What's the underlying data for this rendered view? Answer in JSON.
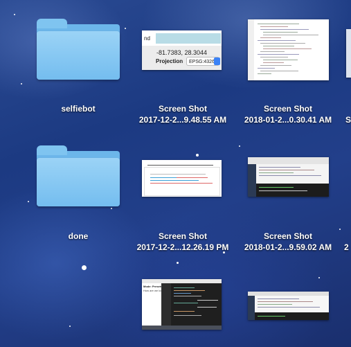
{
  "desktop": {
    "items": [
      {
        "name_line1": "selfiebot",
        "name_line2": ""
      },
      {
        "name_line1": "Screen Shot",
        "name_line2": "2017-12-2...9.48.55 AM"
      },
      {
        "name_line1": "Screen Shot",
        "name_line2": "2018-01-2...0.30.41 AM"
      },
      {
        "name_line1": "done",
        "name_line2": ""
      },
      {
        "name_line1": "Screen Shot",
        "name_line2": "2017-12-2...12.26.19 PM"
      },
      {
        "name_line1": "Screen Shot",
        "name_line2": "2018-01-2...9.59.02 AM"
      }
    ],
    "truncated_right_line2": "2"
  },
  "thumb1": {
    "top_left": "nd",
    "coords": "-81.7383, 28.3044",
    "proj_label": "Projection",
    "proj_value": "EPSG:4326"
  },
  "thumb5": {
    "title_left": "Mode: Presets",
    "subtitle": "How are we looking?"
  }
}
